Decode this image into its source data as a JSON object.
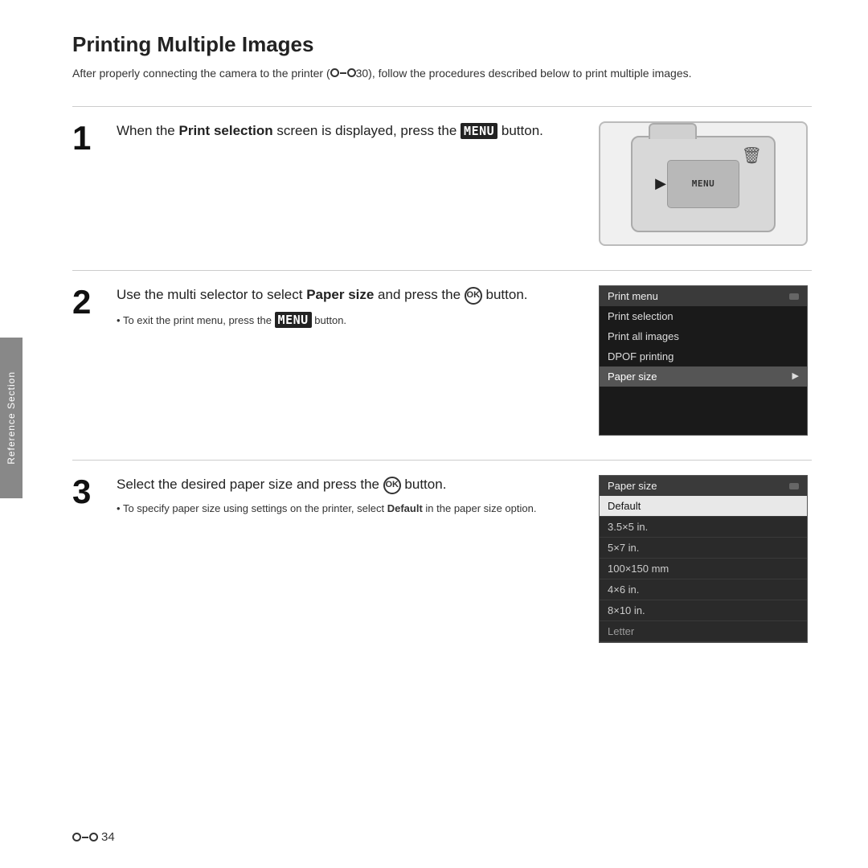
{
  "page": {
    "title": "Printing Multiple Images",
    "intro": "After properly connecting the camera to the printer (⊶30), follow the procedures described below to print multiple images.",
    "sidebar_label": "Reference Section",
    "footer_page": "34"
  },
  "steps": [
    {
      "number": "1",
      "title_parts": [
        "When the ",
        "Print selection",
        " screen is displayed, press the ",
        "MENU",
        " button."
      ],
      "notes": [],
      "has_camera_image": true
    },
    {
      "number": "2",
      "title_parts": [
        "Use the multi selector to select ",
        "Paper size",
        " and press the ",
        "OK",
        " button."
      ],
      "notes": [
        "To exit the print menu, press the MENU button."
      ],
      "has_print_menu": true,
      "print_menu": {
        "header": "Print menu",
        "items": [
          "Print selection",
          "Print all images",
          "DPOF printing"
        ],
        "highlighted": "Paper size"
      }
    },
    {
      "number": "3",
      "title_parts": [
        "Select the desired paper size and press the ",
        "OK",
        " button."
      ],
      "notes": [
        "To specify paper size using settings on the printer, select Default in the paper size option."
      ],
      "has_paper_menu": true,
      "paper_menu": {
        "header": "Paper size",
        "selected": "Default",
        "items": [
          "3.5×5 in.",
          "5×7 in.",
          "100×150 mm",
          "4×6 in.",
          "8×10 in.",
          "Letter"
        ]
      }
    }
  ]
}
